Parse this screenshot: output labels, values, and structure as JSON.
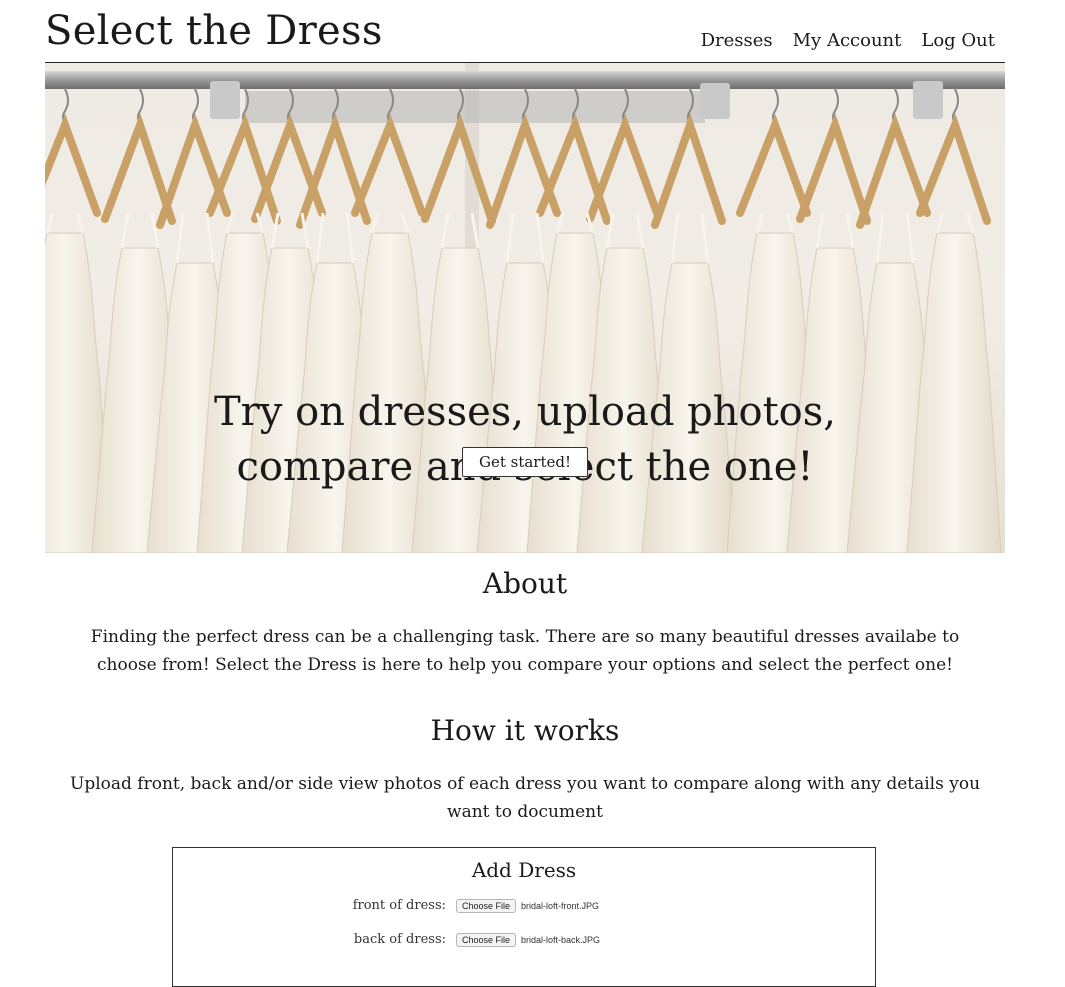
{
  "header": {
    "site_title": "Select the Dress",
    "nav": [
      "Dresses",
      "My Account",
      "Log Out"
    ]
  },
  "hero": {
    "title_line1": "Try on dresses, upload photos,",
    "title_line2": "compare and select the one!",
    "button": "Get started!"
  },
  "about": {
    "heading": "About",
    "text": "Finding the perfect dress can be a challenging task. There are so many beautiful dresses availabe to choose from! Select the Dress is here to help you compare your options and select the perfect one!"
  },
  "how": {
    "heading": "How it works",
    "text": "Upload front, back and/or side view photos of each dress you want to compare along with any details you want to document"
  },
  "form": {
    "heading": "Add Dress",
    "rows": [
      {
        "label": "front of dress:",
        "button": "Choose File",
        "file": "bridal-loft-front.JPG"
      },
      {
        "label": "back of dress:",
        "button": "Choose File",
        "file": "bridal-loft-back.JPG"
      }
    ]
  }
}
